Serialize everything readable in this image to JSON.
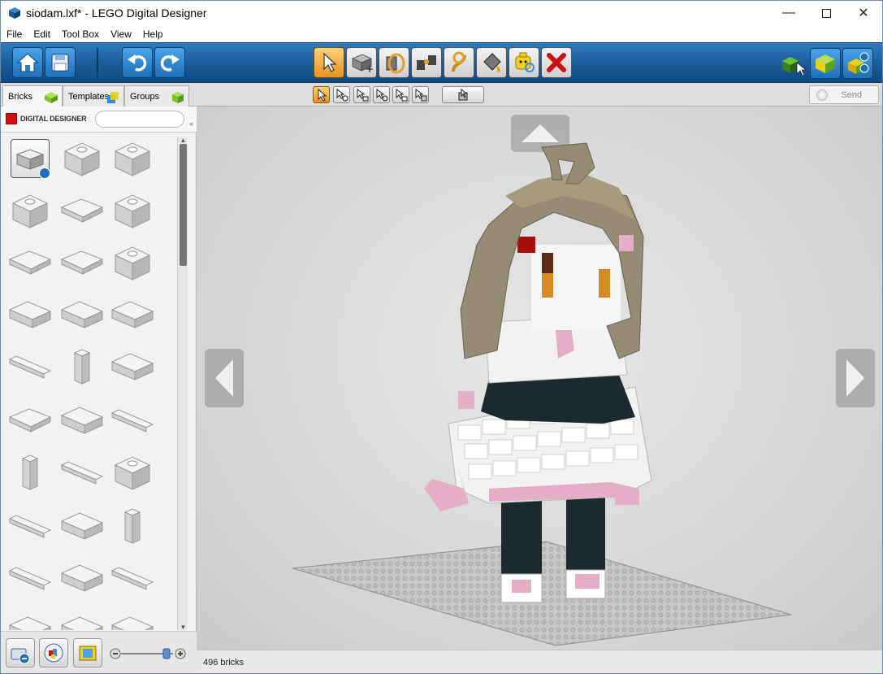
{
  "window": {
    "title": "siodam.lxf* - LEGO Digital Designer"
  },
  "menu": [
    "File",
    "Edit",
    "Tool Box",
    "View",
    "Help"
  ],
  "tabs": {
    "bricks": "Bricks",
    "templates": "Templates",
    "groups": "Groups"
  },
  "brand": {
    "text": "DIGITAL DESIGNER"
  },
  "search": {
    "placeholder": ""
  },
  "send": {
    "label": "Send"
  },
  "status": {
    "brick_count": "496 bricks"
  },
  "icons": {
    "home": "home-icon",
    "save": "save-icon",
    "undo": "undo-icon",
    "redo": "redo-icon",
    "select": "select-cursor-icon",
    "clone": "clone-icon",
    "hinge": "hinge-icon",
    "hinge_align": "hinge-align-icon",
    "flex": "flex-icon",
    "paint": "paint-bucket-icon",
    "decorate": "decoration-icon",
    "delete": "delete-icon",
    "mode_build": "build-mode-icon",
    "mode_view": "view-mode-icon",
    "mode_instructions": "building-guide-icon"
  },
  "colors": {
    "toolbar_blue": "#1a5c99",
    "active_tool": "#e8921a",
    "delete_red": "#d01012",
    "hair_tan": "#958a73",
    "dress_white": "#f2f2f2",
    "dark_teal": "#1b2a2f",
    "pink": "#e4adc8"
  }
}
